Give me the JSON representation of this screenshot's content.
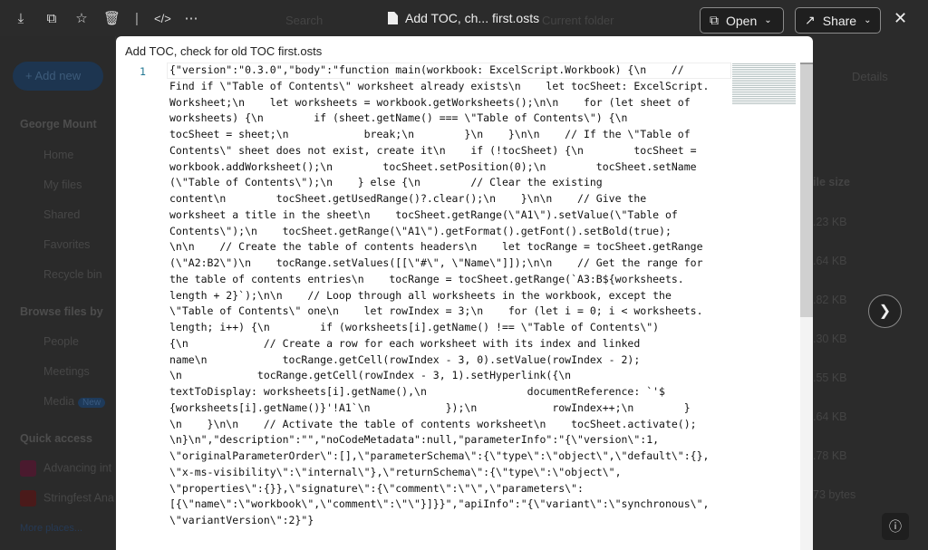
{
  "background": {
    "user": "George Mount",
    "add_new": "+ Add new",
    "search": "Search",
    "scope": "Current folder",
    "details": "Details",
    "file_size_header": "ile size",
    "nav": [
      "Home",
      "My files",
      "Shared",
      "Favorites",
      "Recycle bin"
    ],
    "browse_heading": "Browse files by",
    "browse": [
      "People",
      "Meetings",
      "Media"
    ],
    "new_badge": "New",
    "quick_heading": "Quick access",
    "quick": [
      "Advancing int",
      "Stringfest Ana"
    ],
    "more_places": "More places...",
    "sizes": [
      ".23 KB",
      ".64 KB",
      ".82 KB",
      ".30 KB",
      ".55 KB",
      ".64 KB",
      ".78 KB",
      "73 bytes"
    ]
  },
  "toolbar": {
    "file_title": "Add TOC, ch... first.osts",
    "open_label": "Open",
    "share_label": "Share"
  },
  "viewer": {
    "title": "Add TOC, check for old TOC first.osts",
    "line_number": "1",
    "code_lines": [
      "{\"version\":\"0.3.0\",\"body\":\"function main(workbook: ExcelScript.Workbook) {\\n    //",
      "Find if \\\"Table of Contents\\\" worksheet already exists\\n    let tocSheet: ExcelScript.",
      "Worksheet;\\n    let worksheets = workbook.getWorksheets();\\n\\n    for (let sheet of",
      "worksheets) {\\n        if (sheet.getName() === \\\"Table of Contents\\\") {\\n",
      "tocSheet = sheet;\\n            break;\\n        }\\n    }\\n\\n    // If the \\\"Table of",
      "Contents\\\" sheet does not exist, create it\\n    if (!tocSheet) {\\n        tocSheet =",
      "workbook.addWorksheet();\\n        tocSheet.setPosition(0);\\n        tocSheet.setName",
      "(\\\"Table of Contents\\\");\\n    } else {\\n        // Clear the existing",
      "content\\n        tocSheet.getUsedRange()?.clear();\\n    }\\n\\n    // Give the",
      "worksheet a title in the sheet\\n    tocSheet.getRange(\\\"A1\\\").setValue(\\\"Table of",
      "Contents\\\");\\n    tocSheet.getRange(\\\"A1\\\").getFormat().getFont().setBold(true);",
      "\\n\\n    // Create the table of contents headers\\n    let tocRange = tocSheet.getRange",
      "(\\\"A2:B2\\\")\\n    tocRange.setValues([[\\\"#\\\", \\\"Name\\\"]]);\\n\\n    // Get the range for",
      "the table of contents entries\\n    tocRange = tocSheet.getRange(`A3:B${worksheets.",
      "length + 2}`);\\n\\n    // Loop through all worksheets in the workbook, except the",
      "\\\"Table of Contents\\\" one\\n    let rowIndex = 3;\\n    for (let i = 0; i < worksheets.",
      "length; i++) {\\n        if (worksheets[i].getName() !== \\\"Table of Contents\\\")",
      "{\\n            // Create a row for each worksheet with its index and linked",
      "name\\n            tocRange.getCell(rowIndex - 3, 0).setValue(rowIndex - 2);",
      "\\n            tocRange.getCell(rowIndex - 3, 1).setHyperlink({\\n",
      "textToDisplay: worksheets[i].getName(),\\n                documentReference: `'$",
      "{worksheets[i].getName()}'!A1`\\n            });\\n            rowIndex++;\\n        }",
      "\\n    }\\n\\n    // Activate the table of contents worksheet\\n    tocSheet.activate();",
      "\\n}\\n\",\"description\":\"\",\"noCodeMetadata\":null,\"parameterInfo\":\"{\\\"version\\\":1,",
      "\\\"originalParameterOrder\\\":[],\\\"parameterSchema\\\":{\\\"type\\\":\\\"object\\\",\\\"default\\\":{},",
      "\\\"x-ms-visibility\\\":\\\"internal\\\"},\\\"returnSchema\\\":{\\\"type\\\":\\\"object\\\",",
      "\\\"properties\\\":{}},\\\"signature\\\":{\\\"comment\\\":\\\"\\\",\\\"parameters\\\":",
      "[{\\\"name\\\":\\\"workbook\\\",\\\"comment\\\":\\\"\\\"}]}}\",\"apiInfo\":\"{\\\"variant\\\":\\\"synchronous\\\",",
      "\\\"variantVersion\\\":2}\"}"
    ]
  }
}
